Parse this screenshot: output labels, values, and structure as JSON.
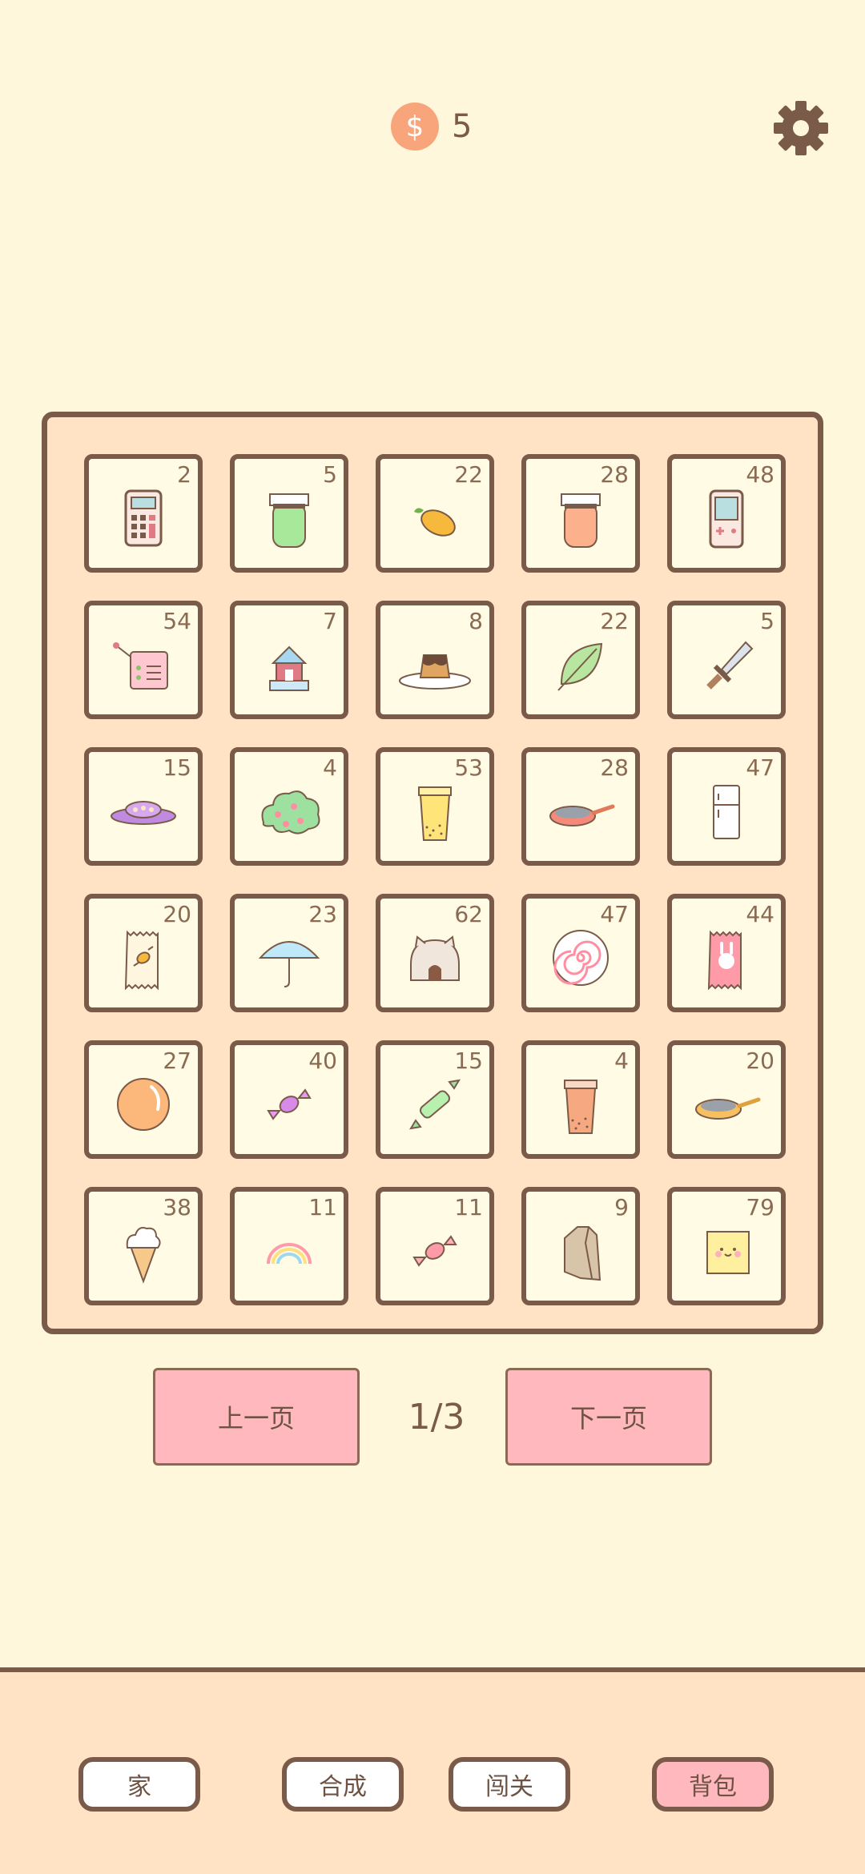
{
  "currency": {
    "icon": "dollar-coin-icon",
    "amount": "5"
  },
  "settings": {
    "icon": "gear-icon"
  },
  "inventory": {
    "slots": [
      {
        "item": "calculator",
        "count": "2"
      },
      {
        "item": "green-jam-jar",
        "count": "5"
      },
      {
        "item": "mango",
        "count": "22"
      },
      {
        "item": "orange-jam-jar",
        "count": "28"
      },
      {
        "item": "handheld-game-console",
        "count": "48"
      },
      {
        "item": "pink-radio",
        "count": "54"
      },
      {
        "item": "small-house",
        "count": "7"
      },
      {
        "item": "pudding",
        "count": "8"
      },
      {
        "item": "leaf",
        "count": "22"
      },
      {
        "item": "sword",
        "count": "5"
      },
      {
        "item": "ufo",
        "count": "15"
      },
      {
        "item": "berry-bush",
        "count": "4"
      },
      {
        "item": "bubble-tea",
        "count": "53"
      },
      {
        "item": "frying-pan",
        "count": "28"
      },
      {
        "item": "fridge",
        "count": "47"
      },
      {
        "item": "candy-bag",
        "count": "20"
      },
      {
        "item": "umbrella",
        "count": "23"
      },
      {
        "item": "cat-house",
        "count": "62"
      },
      {
        "item": "fish-cake",
        "count": "47"
      },
      {
        "item": "bunny-snack-bag",
        "count": "44"
      },
      {
        "item": "orange-ball",
        "count": "27"
      },
      {
        "item": "purple-candy",
        "count": "40"
      },
      {
        "item": "green-candy",
        "count": "15"
      },
      {
        "item": "milk-tea",
        "count": "4"
      },
      {
        "item": "pan",
        "count": "20"
      },
      {
        "item": "ice-cream-cone",
        "count": "38"
      },
      {
        "item": "rainbow",
        "count": "11"
      },
      {
        "item": "pink-candy",
        "count": "11"
      },
      {
        "item": "coffee-bag",
        "count": "9"
      },
      {
        "item": "butter-block",
        "count": "79"
      }
    ]
  },
  "pager": {
    "prev": "上一页",
    "page": "1/3",
    "next": "下一页"
  },
  "nav": {
    "home": "家",
    "merge": "合成",
    "levels": "闯关",
    "bag": "背包",
    "active": "bag"
  },
  "colors": {
    "background": "#fff7dc",
    "panel": "#ffe3c4",
    "border": "#7a5a48",
    "accent_pink": "#ffb8bd",
    "coin": "#f8a57c"
  }
}
